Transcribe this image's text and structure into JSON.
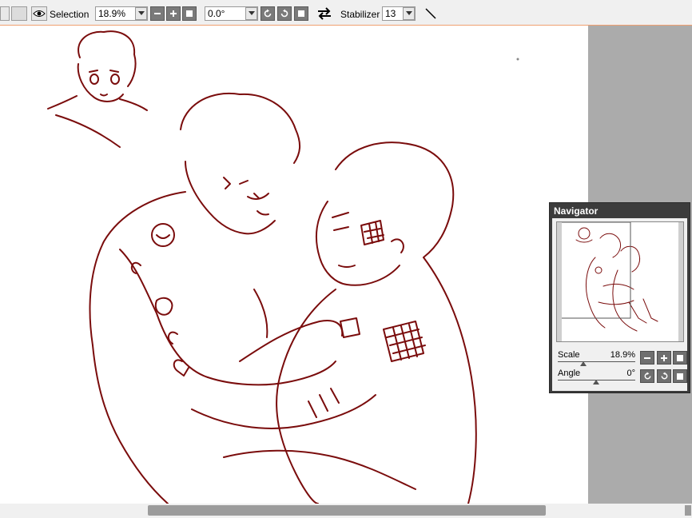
{
  "toolbar": {
    "selection_label": "Selection",
    "zoom_value": "18.9%",
    "angle_value": "0.0°",
    "stabilizer_label": "Stabilizer",
    "stabilizer_value": "13"
  },
  "navigator": {
    "title": "Navigator",
    "scale_label": "Scale",
    "scale_value": "18.9%",
    "angle_label": "Angle",
    "angle_value": "0°"
  },
  "colors": {
    "stroke": "#7a0c0c",
    "toolbar_accent": "#f0a070"
  },
  "icons": [
    "eye-icon",
    "dropdown-arrow-icon",
    "minus-icon",
    "plus-icon",
    "stop-icon",
    "rotate-ccw-icon",
    "rotate-cw-icon",
    "flip-icon",
    "line-tool-icon"
  ]
}
